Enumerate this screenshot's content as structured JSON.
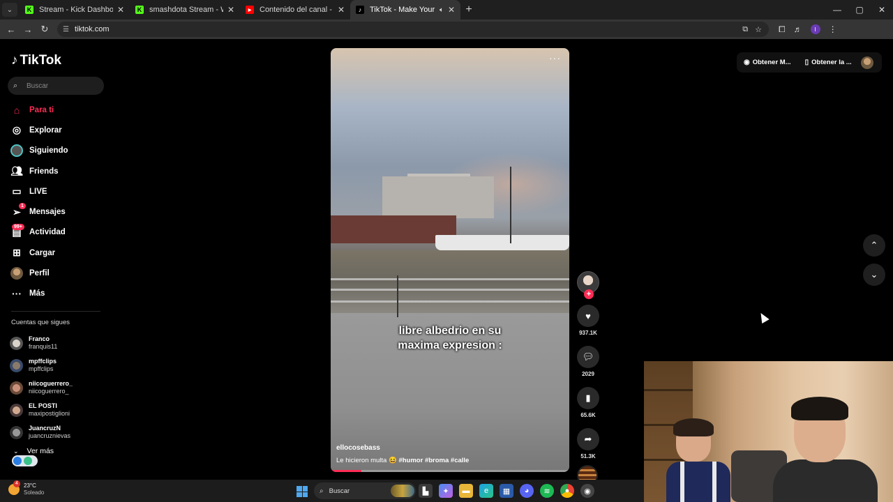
{
  "browser": {
    "tabs": [
      {
        "title": "Stream - Kick Dashboard",
        "fav": "K",
        "fav_color": "#53fc18",
        "active": false
      },
      {
        "title": "smashdota Stream - Watch Live",
        "fav": "K",
        "fav_color": "#53fc18",
        "active": false
      },
      {
        "title": "Contenido del canal - YouTube",
        "fav": "▶",
        "fav_color": "#ff0000",
        "active": false
      },
      {
        "title": "TikTok - Make Your Day",
        "fav": "♪",
        "fav_color": "#000000",
        "active": true
      }
    ],
    "url": "tiktok.com"
  },
  "tiktok": {
    "logo": "TikTok",
    "search_placeholder": "Buscar",
    "nav": [
      {
        "label": "Para ti",
        "icon": "home-icon"
      },
      {
        "label": "Explorar",
        "icon": "compass-icon"
      },
      {
        "label": "Siguiendo",
        "icon": "following-icon"
      },
      {
        "label": "Friends",
        "icon": "friends-icon"
      },
      {
        "label": "LIVE",
        "icon": "live-icon"
      },
      {
        "label": "Mensajes",
        "icon": "messages-icon",
        "badge": "1"
      },
      {
        "label": "Actividad",
        "icon": "activity-icon",
        "badge": "99+"
      },
      {
        "label": "Cargar",
        "icon": "upload-icon"
      },
      {
        "label": "Perfil",
        "icon": "profile-icon"
      },
      {
        "label": "Más",
        "icon": "more-icon"
      }
    ],
    "following_heading": "Cuentas que sigues",
    "following": [
      {
        "name": "Franco",
        "handle": "franquis11"
      },
      {
        "name": "mpffclips",
        "handle": "mpffclips"
      },
      {
        "name": "niicoguerrero_",
        "handle": "niicoguerrero_"
      },
      {
        "name": "EL POSTI",
        "handle": "maxipostiglioni"
      },
      {
        "name": "JuancruzN",
        "handle": "juancruznievas"
      }
    ],
    "see_more": "Ver más",
    "top_right": {
      "btn1": "Obtener M...",
      "btn2": "Obtener la ..."
    },
    "video": {
      "caption_line1": "libre albedrio en su",
      "caption_line2": "maxima expresion :",
      "author": "ellocosebass",
      "description": "Le hicieron multa 😆",
      "hashtags": [
        "#humor",
        "#broma",
        "#calle"
      ],
      "progress": 0.13
    },
    "actions": {
      "likes": "937.1K",
      "comments": "2029",
      "saves": "65.6K",
      "shares": "51.3K"
    }
  },
  "taskbar": {
    "temp": "23°C",
    "condition": "Soleado",
    "weather_badge": "4",
    "search_placeholder": "Buscar"
  }
}
